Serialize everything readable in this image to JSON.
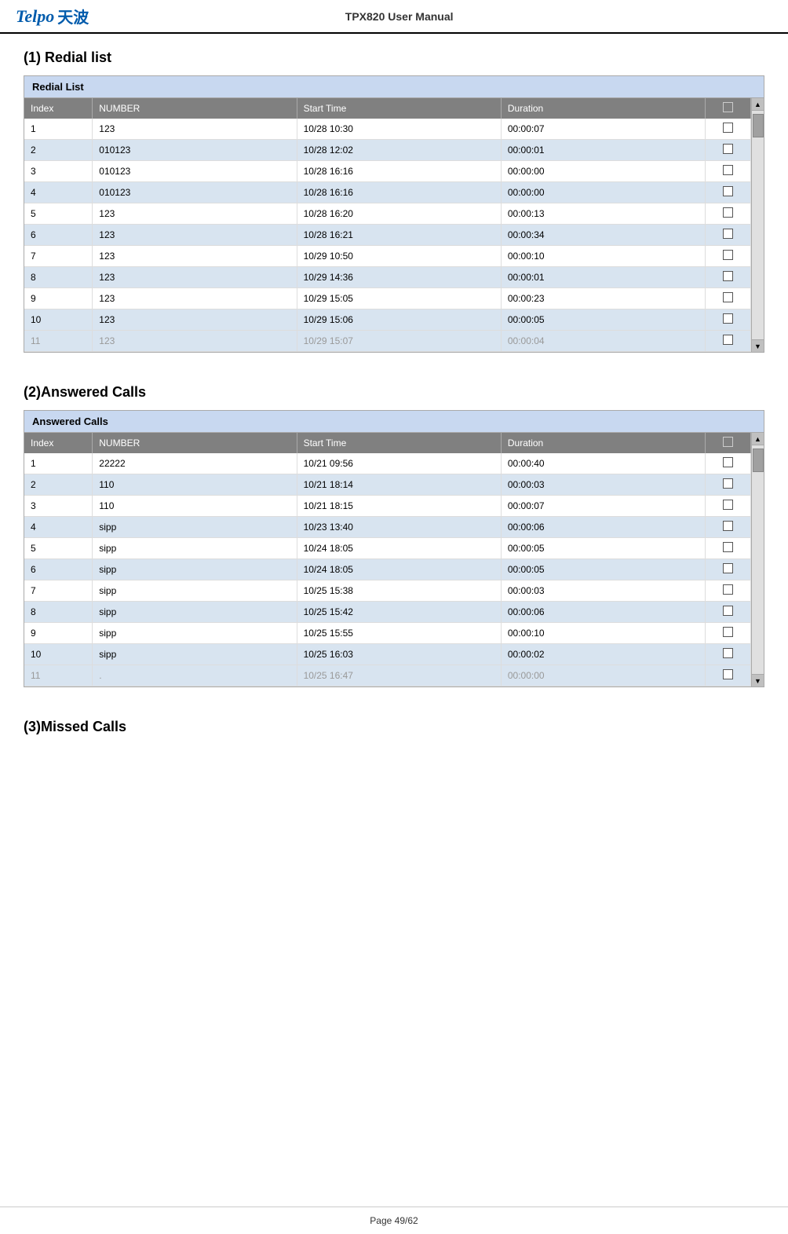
{
  "header": {
    "logo_text": "Telpo",
    "logo_chinese": "天波",
    "title": "TPX820 User Manual"
  },
  "footer": {
    "page_text": "Page 49/62"
  },
  "sections": [
    {
      "id": "redial",
      "heading": "(1) Redial list",
      "table_title": "Redial List",
      "columns": [
        "Index",
        "NUMBER",
        "Start Time",
        "Duration",
        ""
      ],
      "rows": [
        {
          "index": "1",
          "number": "123",
          "start_time": "10/28 10:30",
          "duration": "00:00:07"
        },
        {
          "index": "2",
          "number": "010123",
          "start_time": "10/28 12:02",
          "duration": "00:00:01"
        },
        {
          "index": "3",
          "number": "010123",
          "start_time": "10/28 16:16",
          "duration": "00:00:00"
        },
        {
          "index": "4",
          "number": "010123",
          "start_time": "10/28 16:16",
          "duration": "00:00:00"
        },
        {
          "index": "5",
          "number": "123",
          "start_time": "10/28 16:20",
          "duration": "00:00:13"
        },
        {
          "index": "6",
          "number": "123",
          "start_time": "10/28 16:21",
          "duration": "00:00:34"
        },
        {
          "index": "7",
          "number": "123",
          "start_time": "10/29 10:50",
          "duration": "00:00:10"
        },
        {
          "index": "8",
          "number": "123",
          "start_time": "10/29 14:36",
          "duration": "00:00:01"
        },
        {
          "index": "9",
          "number": "123",
          "start_time": "10/29 15:05",
          "duration": "00:00:23"
        },
        {
          "index": "10",
          "number": "123",
          "start_time": "10/29 15:06",
          "duration": "00:00:05"
        }
      ],
      "partial_row": {
        "index": "11",
        "number": "123",
        "start_time": "10/29 15:07",
        "duration": "00:00:04"
      }
    },
    {
      "id": "answered",
      "heading": "(2)Answered Calls",
      "table_title": "Answered Calls",
      "columns": [
        "Index",
        "NUMBER",
        "Start Time",
        "Duration",
        ""
      ],
      "rows": [
        {
          "index": "1",
          "number": "22222",
          "start_time": "10/21 09:56",
          "duration": "00:00:40"
        },
        {
          "index": "2",
          "number": "110",
          "start_time": "10/21 18:14",
          "duration": "00:00:03"
        },
        {
          "index": "3",
          "number": "110",
          "start_time": "10/21 18:15",
          "duration": "00:00:07"
        },
        {
          "index": "4",
          "number": "sipp",
          "start_time": "10/23 13:40",
          "duration": "00:00:06"
        },
        {
          "index": "5",
          "number": "sipp",
          "start_time": "10/24 18:05",
          "duration": "00:00:05"
        },
        {
          "index": "6",
          "number": "sipp",
          "start_time": "10/24 18:05",
          "duration": "00:00:05"
        },
        {
          "index": "7",
          "number": "sipp",
          "start_time": "10/25 15:38",
          "duration": "00:00:03"
        },
        {
          "index": "8",
          "number": "sipp",
          "start_time": "10/25 15:42",
          "duration": "00:00:06"
        },
        {
          "index": "9",
          "number": "sipp",
          "start_time": "10/25 15:55",
          "duration": "00:00:10"
        },
        {
          "index": "10",
          "number": "sipp",
          "start_time": "10/25 16:03",
          "duration": "00:00:02"
        }
      ],
      "partial_row": {
        "index": "11",
        "number": ".",
        "start_time": "10/25 16:47",
        "duration": "00:00:00"
      }
    }
  ],
  "missed_section": {
    "heading": "(3)Missed Calls"
  }
}
